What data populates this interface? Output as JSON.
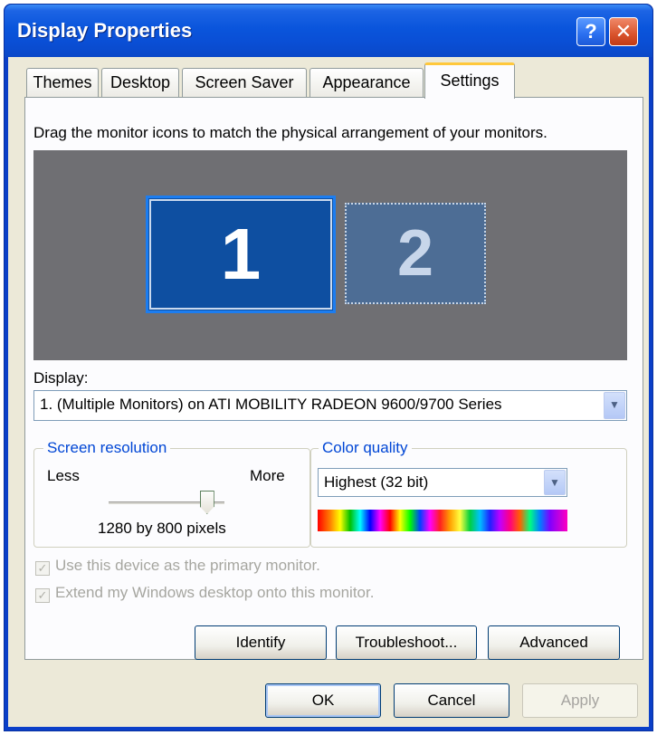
{
  "window": {
    "title": "Display Properties",
    "help_glyph": "?",
    "close_glyph": "✕"
  },
  "tabs": [
    {
      "label": "Themes",
      "active": false
    },
    {
      "label": "Desktop",
      "active": false
    },
    {
      "label": "Screen Saver",
      "active": false
    },
    {
      "label": "Appearance",
      "active": false
    },
    {
      "label": "Settings",
      "active": true
    }
  ],
  "settings": {
    "instruction": "Drag the monitor icons to match the physical arrangement of your monitors.",
    "monitors": [
      {
        "label": "1",
        "selected": true
      },
      {
        "label": "2",
        "selected": false
      }
    ],
    "display_label": "Display:",
    "display_value": "1. (Multiple Monitors) on ATI MOBILITY RADEON 9600/9700 Series",
    "resolution": {
      "group_label": "Screen resolution",
      "less_label": "Less",
      "more_label": "More",
      "value_text": "1280 by 800 pixels",
      "slider_fraction": 0.85
    },
    "color_quality": {
      "group_label": "Color quality",
      "value": "Highest (32 bit)"
    },
    "primary_monitor_checkbox": {
      "label": "Use this device as the primary monitor.",
      "checked": true,
      "disabled": true
    },
    "extend_desktop_checkbox": {
      "label": "Extend my Windows desktop onto this monitor.",
      "checked": true,
      "disabled": true
    },
    "buttons": {
      "identify": "Identify",
      "troubleshoot": "Troubleshoot...",
      "advanced": "Advanced"
    }
  },
  "footer": {
    "ok": "OK",
    "cancel": "Cancel",
    "apply": "Apply"
  },
  "colors": {
    "title_bar": "#0a55dc",
    "dialog_bg": "#ece9d8",
    "group_label": "#0046d5",
    "monitor_bg": "#6f6f73"
  }
}
